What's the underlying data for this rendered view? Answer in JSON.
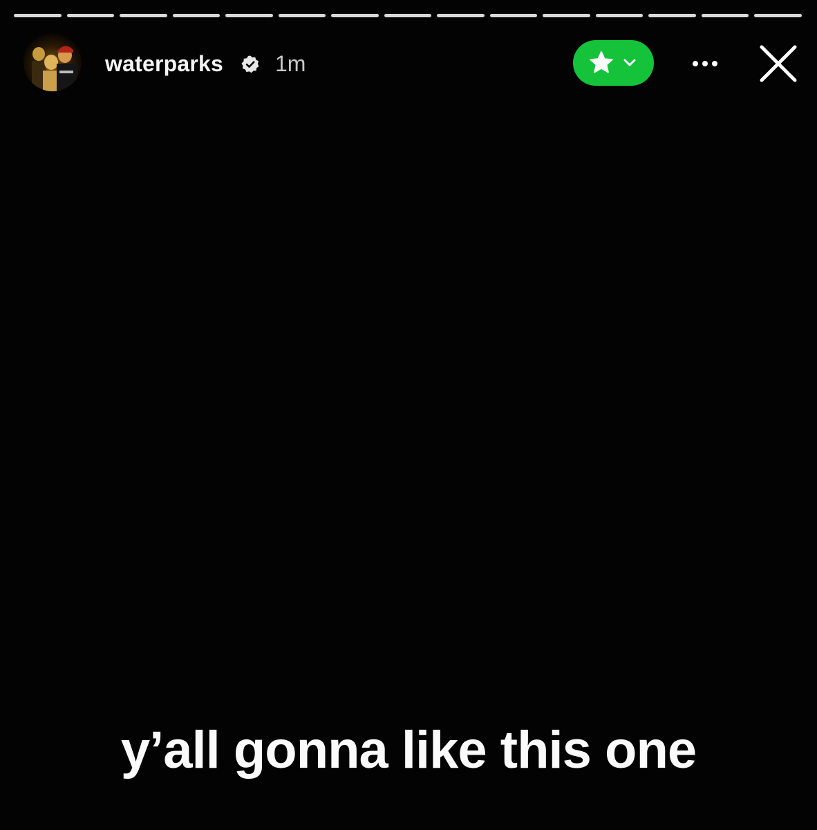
{
  "story": {
    "segments_total": 15,
    "segments_seen": 15
  },
  "header": {
    "username": "waterparks",
    "timestamp": "1m",
    "verified_icon": "verified-badge-icon",
    "avatar_icon": "profile-avatar",
    "close_friends_icon": "star-icon",
    "more_icon": "more-horizontal-icon",
    "close_icon": "close-icon"
  },
  "caption": {
    "text": "y’all gonna like this one"
  },
  "colors": {
    "background": "#030303",
    "close_friends_green": "#14c33a",
    "text": "#ffffff"
  }
}
